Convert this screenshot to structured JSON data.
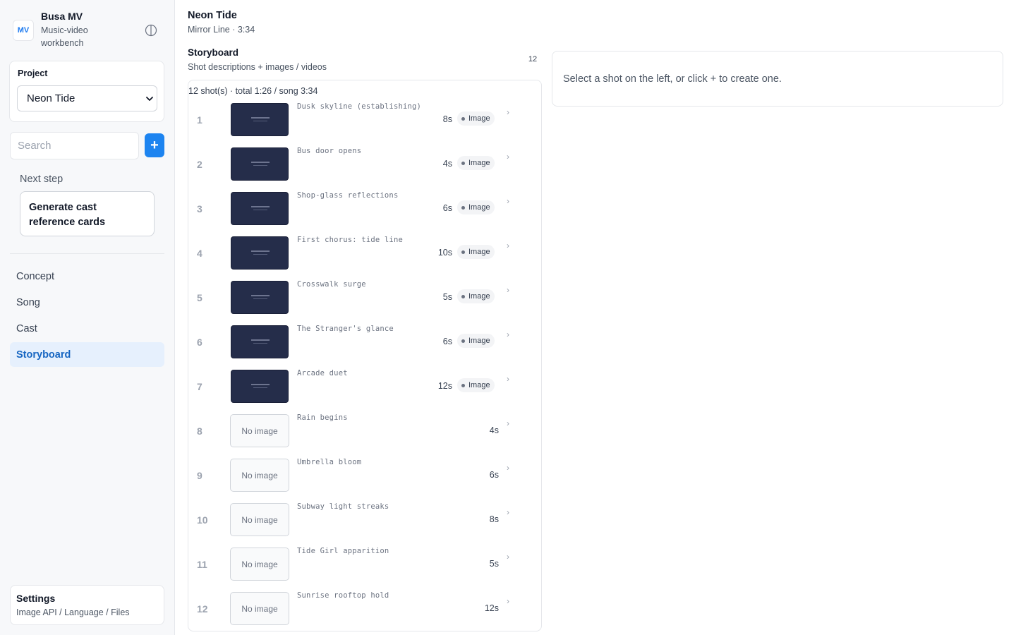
{
  "brand": {
    "logo": "MV",
    "name": "Busa MV",
    "subtitle": "Music-video workbench",
    "theme_toggle_icon": "half-circle-icon"
  },
  "project": {
    "label": "Project",
    "selected": "Neon Tide",
    "options": [
      "Neon Tide"
    ]
  },
  "search": {
    "placeholder": "Search",
    "value": ""
  },
  "add_button": {
    "label": "+"
  },
  "next_step": {
    "label": "Next step",
    "action": "Generate cast reference cards"
  },
  "nav": {
    "items": [
      {
        "label": "Concept",
        "active": false
      },
      {
        "label": "Song",
        "active": false
      },
      {
        "label": "Cast",
        "active": false
      },
      {
        "label": "Storyboard",
        "active": true
      }
    ]
  },
  "settings": {
    "title": "Settings",
    "subtitle": "Image API / Language / Files"
  },
  "song": {
    "title": "Neon Tide",
    "subtitle": "Mirror Line · 3:34"
  },
  "storyboard": {
    "title": "Storyboard",
    "subtitle": "Shot descriptions + images / videos",
    "count_badge": "12",
    "summary": "12 shot(s) · total 1:26 / song 3:34",
    "no_image_label": "No image",
    "shots": [
      {
        "num": "1",
        "desc": "Dusk skyline (establishing)",
        "duration": "8s",
        "has_image": true,
        "type": "Image"
      },
      {
        "num": "2",
        "desc": "Bus door opens",
        "duration": "4s",
        "has_image": true,
        "type": "Image"
      },
      {
        "num": "3",
        "desc": "Shop-glass reflections",
        "duration": "6s",
        "has_image": true,
        "type": "Image"
      },
      {
        "num": "4",
        "desc": "First chorus: tide line",
        "duration": "10s",
        "has_image": true,
        "type": "Image"
      },
      {
        "num": "5",
        "desc": "Crosswalk surge",
        "duration": "5s",
        "has_image": true,
        "type": "Image"
      },
      {
        "num": "6",
        "desc": "The Stranger's glance",
        "duration": "6s",
        "has_image": true,
        "type": "Image"
      },
      {
        "num": "7",
        "desc": "Arcade duet",
        "duration": "12s",
        "has_image": true,
        "type": "Image"
      },
      {
        "num": "8",
        "desc": "Rain begins",
        "duration": "4s",
        "has_image": false,
        "type": ""
      },
      {
        "num": "9",
        "desc": "Umbrella bloom",
        "duration": "6s",
        "has_image": false,
        "type": ""
      },
      {
        "num": "10",
        "desc": "Subway light streaks",
        "duration": "8s",
        "has_image": false,
        "type": ""
      },
      {
        "num": "11",
        "desc": "Tide Girl apparition",
        "duration": "5s",
        "has_image": false,
        "type": ""
      },
      {
        "num": "12",
        "desc": "Sunrise rooftop hold",
        "duration": "12s",
        "has_image": false,
        "type": ""
      }
    ]
  },
  "detail": {
    "empty_message": "Select a shot on the left, or click + to create one."
  },
  "colors": {
    "accent": "#1d84f0",
    "active_nav_bg": "#e6f0fd",
    "active_nav_text": "#1766c2",
    "thumbnail_bg": "#252d4a"
  }
}
